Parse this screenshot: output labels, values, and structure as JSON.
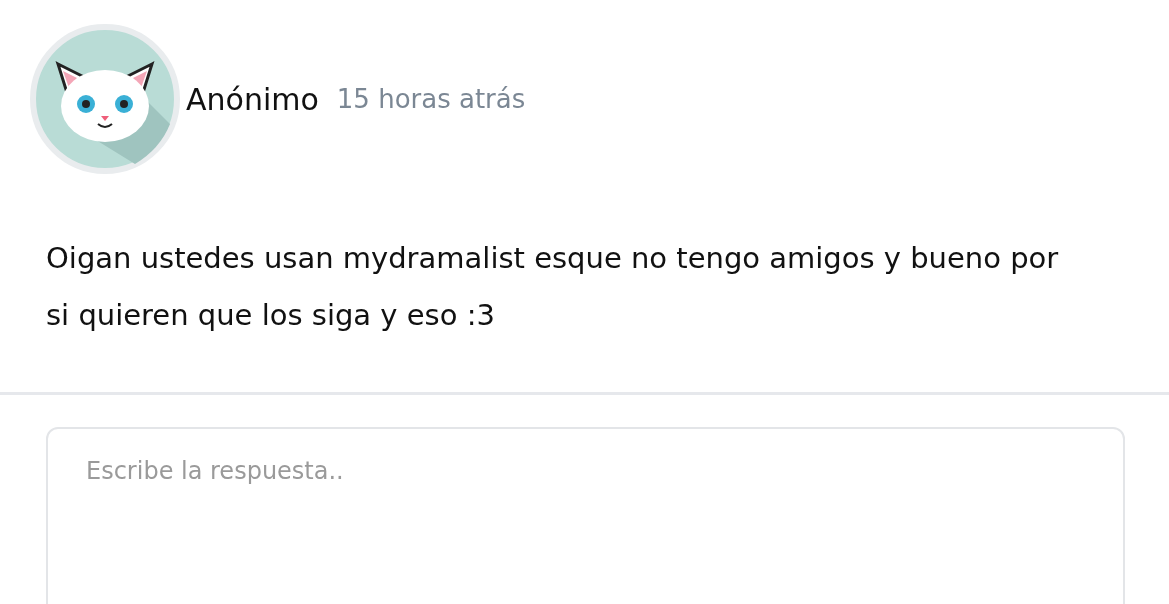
{
  "post": {
    "author": "Anónimo",
    "time": "15 horas atrás",
    "text": "Oigan ustedes usan mydramalist esque no tengo amigos y bueno por si quieren que los siga y eso :3"
  },
  "reply": {
    "placeholder": "Escribe la respuesta.."
  }
}
